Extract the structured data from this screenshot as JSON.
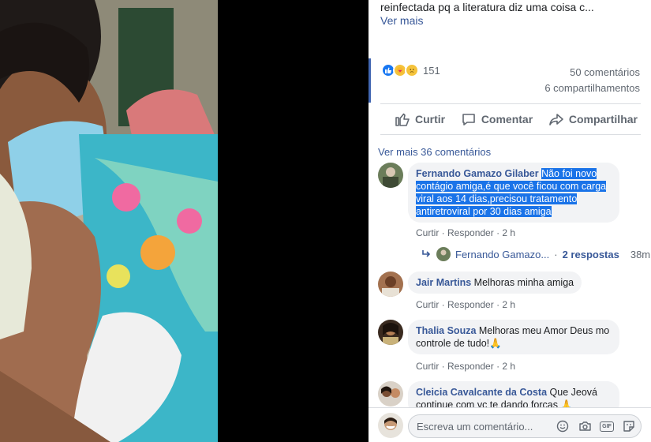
{
  "post": {
    "caption_tail": "reinfectada pq a literatura diz uma coisa c...",
    "see_more": "Ver mais"
  },
  "reactions": {
    "types": [
      "like",
      "love",
      "sad"
    ],
    "count": "151",
    "comments": "50 comentários",
    "shares": "6 compartilhamentos"
  },
  "actions": {
    "like": "Curtir",
    "comment": "Comentar",
    "share": "Compartilhar"
  },
  "comments_section": {
    "see_more": "Ver mais 36 comentários",
    "comments": [
      {
        "author": "Fernando Gamazo Gilaber",
        "text": "Não foi novo contágio amiga,é que você ficou com carga viral aos 14 dias,precisou tratamento antiretroviral por 30 dias amiga",
        "like": "Curtir",
        "reply": "Responder",
        "time": "2 h"
      },
      {
        "author": "Jair Martins",
        "text": "Melhoras minha amiga",
        "like": "Curtir",
        "reply": "Responder",
        "time": "2 h"
      },
      {
        "author": "Thalia Souza",
        "text": "Melhoras meu Amor Deus mo controle de tudo!🙏",
        "like": "Curtir",
        "reply": "Responder",
        "time": "2 h"
      },
      {
        "author": "Cleicia Cavalcante da Costa",
        "text": "Que Jeová continue com vc te dando forças 🙏"
      }
    ],
    "reply_thread": {
      "name": "Fernando Gamazo...",
      "separator": "·",
      "replies": "2 respostas",
      "time": "38m"
    }
  },
  "composer": {
    "placeholder": "Escreva um comentário...",
    "icons": [
      "emoji-icon",
      "camera-icon",
      "gif-icon",
      "sticker-icon"
    ],
    "gif_label": "GIF"
  },
  "colors": {
    "link": "#385898",
    "accent": "#4267b2",
    "highlight": "#1a73e8"
  }
}
